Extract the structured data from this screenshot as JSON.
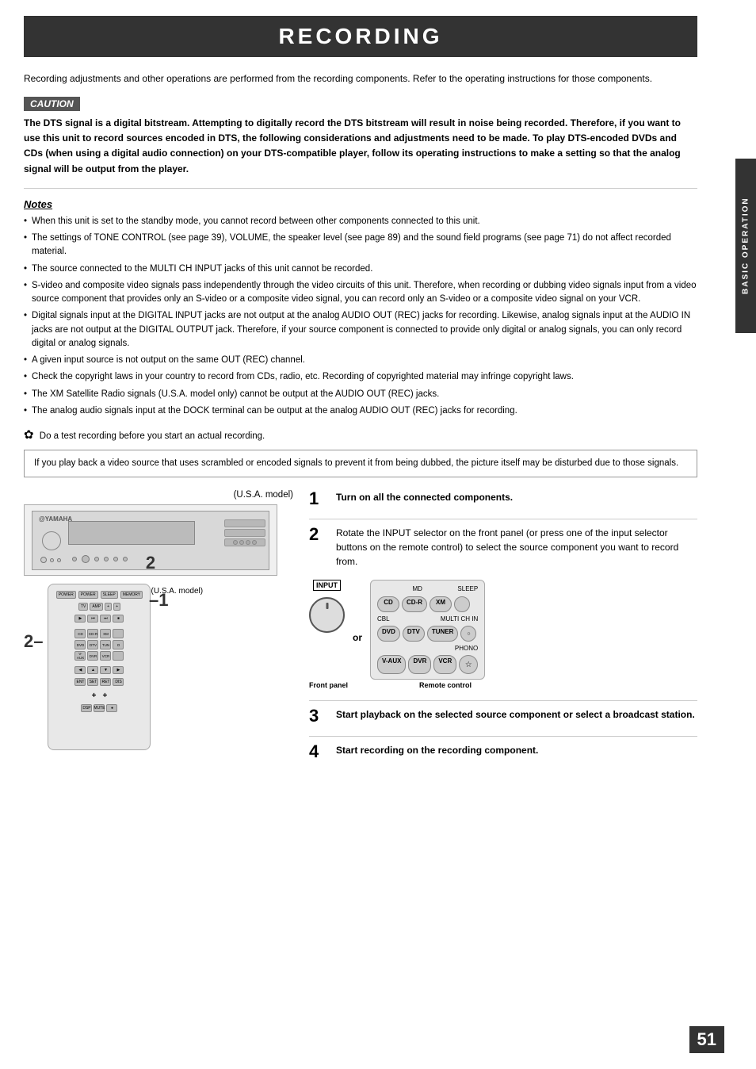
{
  "page": {
    "title": "RECORDING",
    "number": "51"
  },
  "sidebar": {
    "label": "BASIC OPERATION"
  },
  "intro": {
    "text": "Recording adjustments and other operations are performed from the recording components. Refer to the operating instructions for those components."
  },
  "caution": {
    "label": "CAUTION",
    "text": "The DTS signal is a digital bitstream. Attempting to digitally record the DTS bitstream will result in noise being recorded. Therefore, if you want to use this unit to record sources encoded in DTS, the following considerations and adjustments need to be made. To play DTS-encoded DVDs and CDs (when using a digital audio connection) on your DTS-compatible player, follow its operating instructions to make a setting so that the analog signal will be output from the player."
  },
  "notes": {
    "label": "Notes",
    "items": [
      "When this unit is set to the standby mode, you cannot record between other components connected to this unit.",
      "The settings of TONE CONTROL (see page 39), VOLUME, the speaker level (see page 89) and the sound field programs (see page 71) do not affect recorded material.",
      "The source connected to the MULTI CH INPUT jacks of this unit cannot be recorded.",
      "S-video and composite video signals pass independently through the video circuits of this unit. Therefore, when recording or dubbing video signals input from a video source component that provides only an S-video or a composite video signal, you can record only an S-video or a composite video signal on your VCR.",
      "Digital signals input at the DIGITAL INPUT jacks are not output at the analog AUDIO OUT (REC) jacks for recording. Likewise, analog signals input at the AUDIO IN jacks are not output at the DIGITAL OUTPUT jack. Therefore, if your source component is connected to provide only digital or analog signals, you can only record digital or analog signals.",
      "A given input source is not output on the same OUT (REC) channel.",
      "Check the copyright laws in your country to record from CDs, radio, etc. Recording of copyrighted material may infringe copyright laws.",
      "The XM Satellite Radio signals (U.S.A. model only) cannot be output at the AUDIO OUT (REC) jacks.",
      "The analog audio signals input at the DOCK terminal can be output at the analog AUDIO OUT (REC) jacks for recording."
    ]
  },
  "tip": {
    "icon": "☀",
    "text": "Do a test recording before you start an actual recording."
  },
  "infobox": {
    "text": "If you play back a video source that uses scrambled or encoded signals to prevent it from being dubbed, the picture itself may be disturbed due to those signals."
  },
  "diagram": {
    "usa_model_label": "(U.S.A. model)",
    "usa_model_label2": "(U.S.A. model)"
  },
  "steps": [
    {
      "number": "1",
      "text": "Turn on all the connected components."
    },
    {
      "number": "2",
      "text": "Rotate the INPUT selector on the front panel (or press one of the input selector buttons on the remote control) to select the source component you want to record from."
    },
    {
      "number": "3",
      "text": "Start playback on the selected source component or select a broadcast station."
    },
    {
      "number": "4",
      "text": "Start recording on the recording component."
    }
  ],
  "input_labels": {
    "input": "INPUT",
    "front_panel": "Front panel",
    "remote_control": "Remote control",
    "or": "or"
  },
  "remote_buttons": {
    "row1": [
      "MD",
      "SLEEP"
    ],
    "row2_labels": [
      "CD",
      "CD-R",
      "XM"
    ],
    "row3_labels": [
      "CBL",
      "MULTI CH IN"
    ],
    "row4_labels": [
      "DVD",
      "DTV",
      "TUNER"
    ],
    "row5_labels": [
      "PHONO"
    ],
    "row6_labels": [
      "V-AUX",
      "DVR",
      "VCR"
    ]
  }
}
